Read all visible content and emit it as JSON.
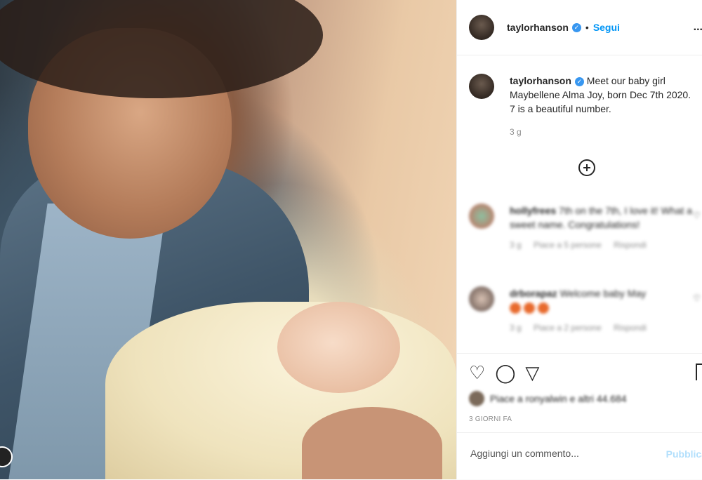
{
  "post": {
    "username": "taylorhanson",
    "dot": "•",
    "follow_label": "Segui",
    "more_label": "...",
    "caption": "Meet our baby girl Maybellene Alma Joy, born Dec 7th 2020. 7 is a beautiful number.",
    "caption_time": "3 g"
  },
  "comments": [
    {
      "username": "hollyfrees",
      "text": "7th on the 7th, I love it! What a sweet name. Congratulations!",
      "time": "3 g",
      "likes": "Piace a 5 persone",
      "reply": "Rispondi"
    },
    {
      "username": "drborapaz",
      "text": "Welcome baby May",
      "time": "3 g",
      "likes": "Piace a 2 persone",
      "reply": "Rispondi"
    }
  ],
  "actions": {
    "liked_by": "Piace a ronyalwin e altri 44.684",
    "posted_ago": "3 GIORNI FA",
    "comment_placeholder": "Aggiungi un commento...",
    "publish_label": "Pubblica"
  },
  "icons": [
    "heart-icon",
    "comment-icon",
    "share-icon",
    "bookmark-icon",
    "add-circle-icon"
  ],
  "colors": {
    "accent": "#0095f6",
    "verified": "#3897f0",
    "publish_disabled": "#b2dffc"
  }
}
